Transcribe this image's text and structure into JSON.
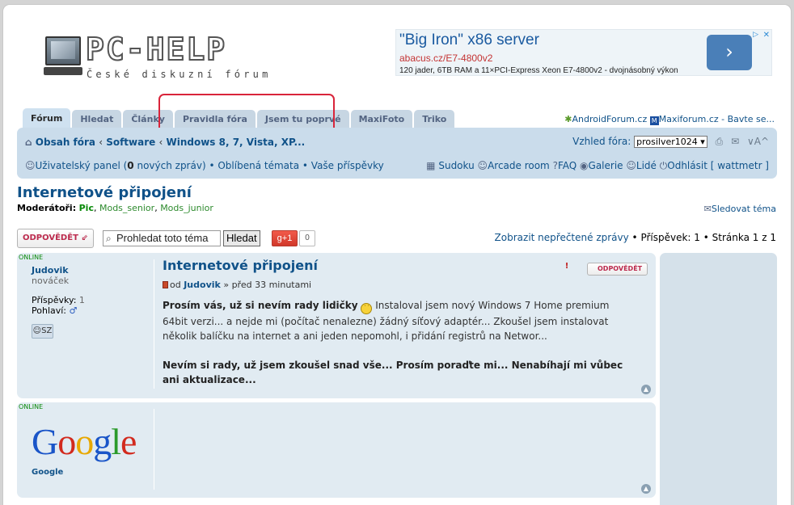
{
  "header": {
    "logo_text": "PC-HELP",
    "tagline": "České diskuzní fórum"
  },
  "ad": {
    "title": "\"Big Iron\" x86 server",
    "url": "abacus.cz/E7-4800v2",
    "description": "120 jader, 6TB RAM a 11×PCI-Express Xeon E7-4800v2 - dvojnásobný výkon",
    "button_icon": "›",
    "close_icon": "✕",
    "adchoices_icon": "▷"
  },
  "tabs": [
    {
      "label": "Fórum"
    },
    {
      "label": "Hledat"
    },
    {
      "label": "Články"
    },
    {
      "label": "Pravidla fóra"
    },
    {
      "label": "Jsem tu poprvé"
    },
    {
      "label": "MaxiFoto"
    },
    {
      "label": "Triko"
    }
  ],
  "partners": {
    "android": "AndroidForum.cz",
    "maxi": "Maxiforum.cz - Bavte se..."
  },
  "navbar": {
    "crumbs": [
      "Obsah fóra",
      "Software",
      "Windows 8, 7, Vista, XP..."
    ],
    "crumb_sep": "‹",
    "style_label": "Vzhled fóra:",
    "style_value": "prosilver1024",
    "user_panel_prefix": "Uživatelský panel (",
    "new_messages_count": "0",
    "user_panel_suffix": " nových zpráv)",
    "bullet": "•",
    "favorites": "Oblíbená témata",
    "your_posts": "Vaše příspěvky",
    "sudoku": "Sudoku",
    "arcade": "Arcade room",
    "faq": "FAQ",
    "gallery": "Galerie",
    "users": "Lidé",
    "logout": "Odhlásit [ wattmetr ]"
  },
  "topic": {
    "title": "Internetové připojení",
    "moderators_label": "Moderátoři:",
    "moderators": [
      "Pic",
      "Mods_senior",
      "Mods_junior"
    ],
    "watch_label": "Sledovat téma"
  },
  "actions": {
    "reply_label": "ODPOVĚDĚT",
    "search_placeholder": "Prohledat toto téma…",
    "search_value": "Prohledat toto téma",
    "search_button": "Hledat",
    "gplus_label": "g+1",
    "gplus_count": "0",
    "unread_link": "Zobrazit nepřečtené zprávy",
    "posts_label": "Příspěvek: 1",
    "page_label": "Stránka 1 z 1"
  },
  "posts": [
    {
      "online": "ONLINE",
      "author": "Judovik",
      "rank": "nováček",
      "posts_label": "Příspěvky:",
      "posts_count": "1",
      "gender_label": "Pohlaví:",
      "gender_icon": "♂",
      "pm_label": "SZ",
      "title": "Internetové připojení",
      "meta_prefix": "od",
      "meta_time": "» před 33 minutami",
      "text_bold_1": "Prosím vás, už si nevím rady lidičky",
      "text_1": " Instaloval jsem nový Windows 7 Home premium 64bit verzi... a nejde mi (počítač nenalezne) žádný síťový adaptér... Zkoušel jsem instalovat několik balíčku na internet a ani jeden nepomohl, i přidání registrů na Networ...",
      "text_bold_2": "Nevím si rady, už jsem zkoušel snad vše... Prosím poraďte mi... Nenabíhají mi vůbec ani aktualizace...",
      "quote_label": "ODPOVĚDĚT",
      "report_icon": "!"
    },
    {
      "online": "ONLINE",
      "author": "Google",
      "logo_letters": [
        "G",
        "o",
        "o",
        "g",
        "l",
        "e"
      ],
      "logo_colors": [
        "#1a55c8",
        "#d22a1e",
        "#e8a800",
        "#1a55c8",
        "#2a9a2a",
        "#d22a1e"
      ]
    }
  ]
}
